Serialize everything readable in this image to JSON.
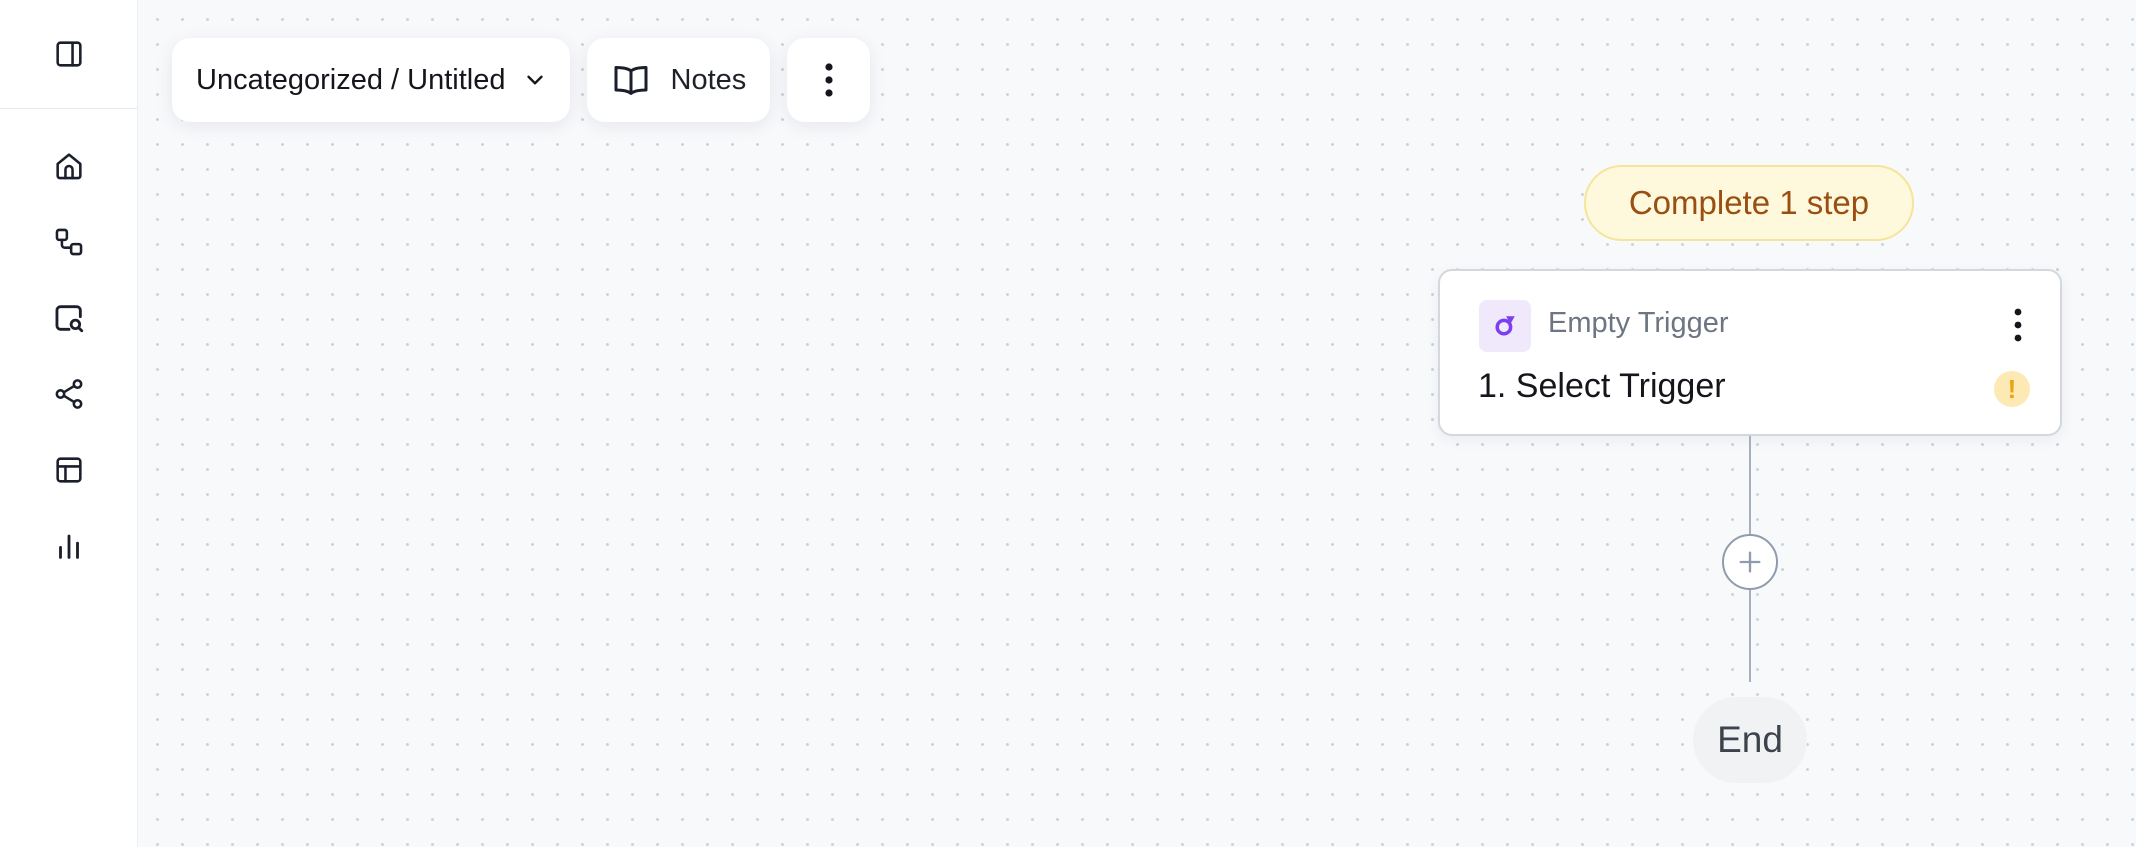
{
  "sidebar": {
    "toggle_icon": "sidebar-panel-icon",
    "items": [
      {
        "id": "home",
        "icon": "home-icon"
      },
      {
        "id": "workflows",
        "icon": "workflow-icon"
      },
      {
        "id": "executions",
        "icon": "search-screen-icon"
      },
      {
        "id": "connections",
        "icon": "share-nodes-icon"
      },
      {
        "id": "tables",
        "icon": "table-icon"
      },
      {
        "id": "analytics",
        "icon": "bar-chart-icon"
      }
    ]
  },
  "toolbar": {
    "breadcrumb": "Uncategorized / Untitled",
    "notes_label": "Notes"
  },
  "flow": {
    "status_text": "Complete 1 step",
    "trigger": {
      "type_label": "Empty Trigger",
      "title": "1. Select Trigger",
      "warning_symbol": "!"
    },
    "end_label": "End"
  },
  "colors": {
    "accent_purple": "#7b3ff2",
    "warning_bg": "#fef8dc",
    "warning_text": "#9a4f12",
    "connector": "#a4b0bf"
  }
}
